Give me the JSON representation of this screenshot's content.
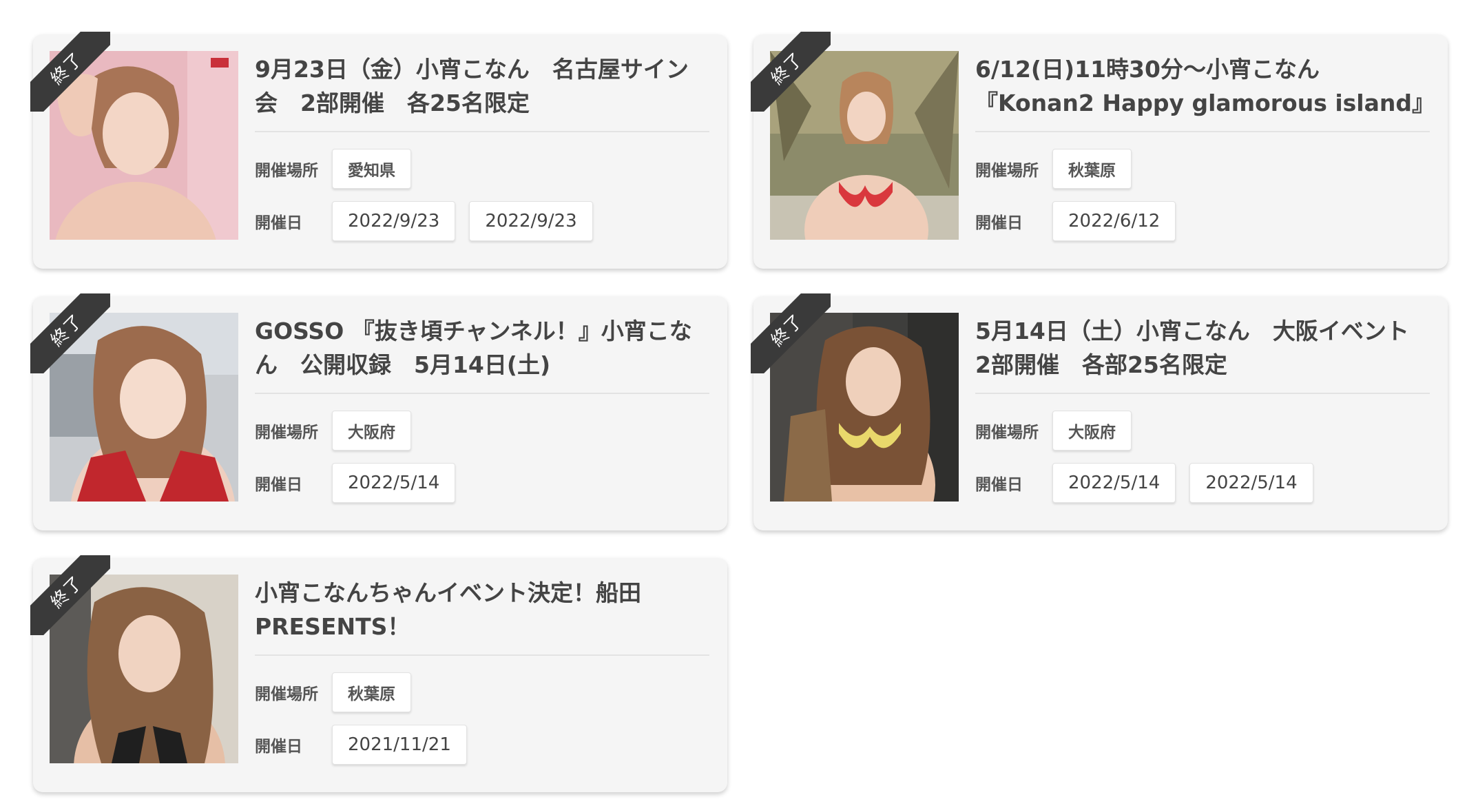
{
  "status_label": "終了",
  "place_label": "開催場所",
  "date_label": "開催日",
  "events": [
    {
      "title": "9月23日（金）小宵こなん　名古屋サイン会　2部開催　各25名限定",
      "place": "愛知県",
      "dates": [
        "2022/9/23",
        "2022/9/23"
      ],
      "image_icon": "photo-thumbnail"
    },
    {
      "title": "6/12(日)11時30分〜小宵こなん『Konan2 Happy glamorous island』",
      "place": "秋葉原",
      "dates": [
        "2022/6/12"
      ],
      "image_icon": "photo-thumbnail"
    },
    {
      "title": "GOSSO 『抜き頃チャンネル！』小宵こなん　公開収録　5月14日(土)",
      "place": "大阪府",
      "dates": [
        "2022/5/14"
      ],
      "image_icon": "photo-thumbnail"
    },
    {
      "title": "5月14日（土）小宵こなん　大阪イベント　2部開催　各部25名限定",
      "place": "大阪府",
      "dates": [
        "2022/5/14",
        "2022/5/14"
      ],
      "image_icon": "photo-thumbnail"
    },
    {
      "title": "小宵こなんちゃんイベント決定！船田PRESENTS！",
      "place": "秋葉原",
      "dates": [
        "2021/11/21"
      ],
      "image_icon": "photo-thumbnail"
    }
  ],
  "colors": {
    "card_bg": "#f5f5f5",
    "ribbon_bg": "#3a3a3a",
    "tag_bg": "#ffffff",
    "title_text": "#444444"
  }
}
